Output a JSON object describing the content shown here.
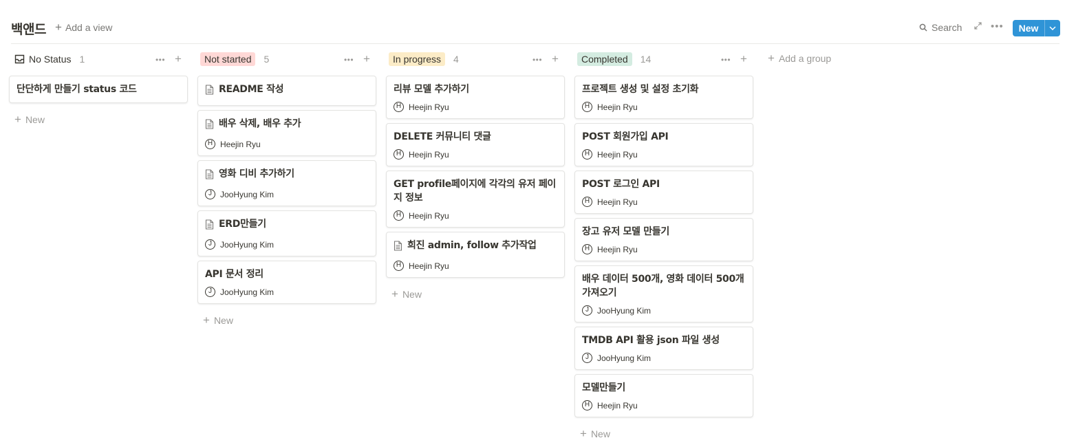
{
  "header": {
    "title": "백앤드",
    "add_view": "Add a view",
    "search": "Search",
    "new_label": "New"
  },
  "add_group": "Add a group",
  "new_label": "New",
  "colors": {
    "not_started": "#ffd8d6",
    "in_progress": "#fcecc7",
    "completed": "#d4ece1",
    "accent": "#2f94d7"
  },
  "columns": [
    {
      "name": "No Status",
      "count": "1",
      "icon": "inbox-icon",
      "cards": [
        {
          "title": "단단하게 만들기 status 코드",
          "doc": false,
          "person": "",
          "initial": ""
        }
      ]
    },
    {
      "name": "Not started",
      "count": "5",
      "cards": [
        {
          "title": "README 작성",
          "doc": true,
          "person": "",
          "initial": ""
        },
        {
          "title": "배우 삭제, 배우 추가",
          "doc": true,
          "person": "Heejin Ryu",
          "initial": "H"
        },
        {
          "title": "영화 디비 추가하기",
          "doc": true,
          "person": "JooHyung Kim",
          "initial": "J"
        },
        {
          "title": "ERD만들기",
          "doc": true,
          "person": "JooHyung Kim",
          "initial": "J"
        },
        {
          "title": "API 문서 정리",
          "doc": false,
          "person": "JooHyung Kim",
          "initial": "J"
        }
      ]
    },
    {
      "name": "In progress",
      "count": "4",
      "cards": [
        {
          "title": "리뷰 모델 추가하기",
          "doc": false,
          "person": "Heejin Ryu",
          "initial": "H"
        },
        {
          "title": "DELETE 커뮤니티 댓글",
          "doc": false,
          "person": "Heejin Ryu",
          "initial": "H"
        },
        {
          "title": "GET profile페이지에 각각의 유저 페이지 정보",
          "doc": false,
          "person": "Heejin Ryu",
          "initial": "H"
        },
        {
          "title": "희진 admin, follow 추가작업",
          "doc": true,
          "person": "Heejin Ryu",
          "initial": "H"
        }
      ]
    },
    {
      "name": "Completed",
      "count": "14",
      "cards": [
        {
          "title": "프로젝트 생성 및 설정 초기화",
          "doc": false,
          "person": "Heejin Ryu",
          "initial": "H"
        },
        {
          "title": "POST 회원가입 API",
          "doc": false,
          "person": "Heejin Ryu",
          "initial": "H"
        },
        {
          "title": "POST 로그인 API",
          "doc": false,
          "person": "Heejin Ryu",
          "initial": "H"
        },
        {
          "title": "장고 유저 모델 만들기",
          "doc": false,
          "person": "Heejin Ryu",
          "initial": "H"
        },
        {
          "title": "배우 데이터 500개, 영화 데이터 500개 가져오기",
          "doc": false,
          "person": "JooHyung Kim",
          "initial": "J"
        },
        {
          "title": "TMDB API 활용 json 파일 생성",
          "doc": false,
          "person": "JooHyung Kim",
          "initial": "J"
        },
        {
          "title": "모델만들기",
          "doc": false,
          "person": "Heejin Ryu",
          "initial": "H"
        }
      ]
    }
  ]
}
